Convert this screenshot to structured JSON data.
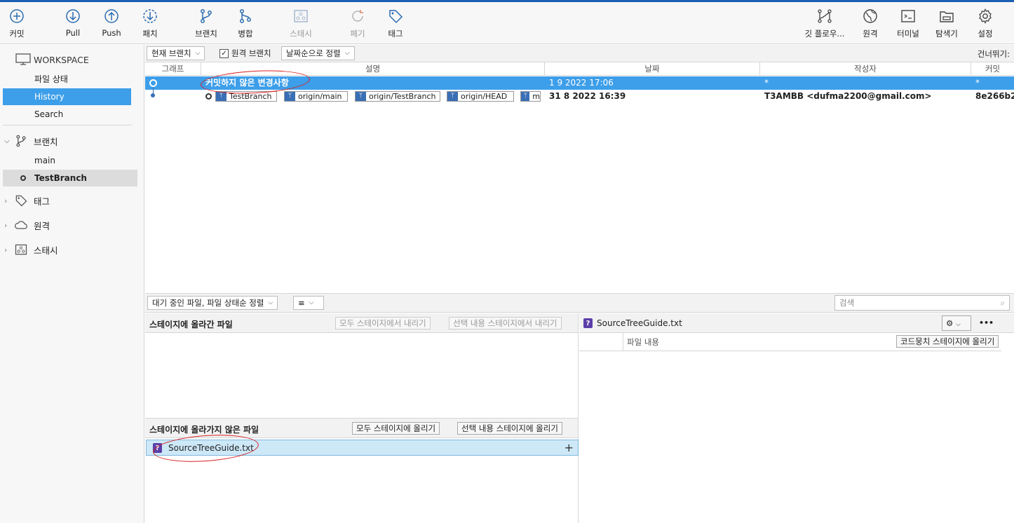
{
  "toolbar": {
    "left": [
      {
        "label": "커밋",
        "icon": "commit-icon"
      },
      {
        "label": "Pull",
        "icon": "pull-icon"
      },
      {
        "label": "Push",
        "icon": "push-icon"
      },
      {
        "label": "패치",
        "icon": "patch-icon"
      },
      {
        "label": "브랜치",
        "icon": "branch-icon"
      },
      {
        "label": "병합",
        "icon": "merge-icon"
      },
      {
        "label": "스태시",
        "icon": "stash-icon"
      },
      {
        "label": "폐기",
        "icon": "discard-icon"
      },
      {
        "label": "태그",
        "icon": "tag-icon"
      }
    ],
    "right": [
      {
        "label": "깃 플로우...",
        "icon": "git-flow-icon"
      },
      {
        "label": "원격",
        "icon": "remote-globe-icon"
      },
      {
        "label": "터미널",
        "icon": "terminal-icon"
      },
      {
        "label": "탐색기",
        "icon": "explorer-icon"
      },
      {
        "label": "설정",
        "icon": "settings-gear-icon"
      }
    ]
  },
  "sidebar": {
    "workspace": "WORKSPACE",
    "workspace_items": [
      "파일 상태",
      "History",
      "Search"
    ],
    "branches_label": "브랜치",
    "branches": [
      "main",
      "TestBranch"
    ],
    "tags_label": "태그",
    "remotes_label": "원격",
    "stashes_label": "스태시"
  },
  "history": {
    "branch_filter": "현재 브랜치",
    "remote_branches_label": "원격 브랜치",
    "sort": "날짜순으로 정렬",
    "jump_label": "건너뛰기:",
    "columns": [
      "그래프",
      "설명",
      "날짜",
      "작성자",
      "커밋"
    ],
    "rows": [
      {
        "description": "커밋하지 않은 변경사항",
        "date": "1 9 2022 17:06",
        "author": "*",
        "commit": "*"
      },
      {
        "refs": [
          "TestBranch",
          "origin/main",
          "origin/TestBranch",
          "origin/HEAD",
          "m"
        ],
        "date": "31 8 2022 16:39",
        "author": "T3AMBB <dufma2200@gmail.com>",
        "commit": "8e266b2"
      }
    ]
  },
  "files": {
    "sort_dropdown": "대기 중인 파일, 파일 상태순 정렬",
    "view_dropdown": "≡",
    "search_placeholder": "검색",
    "staged_title": "스테이지에 올라간 파일",
    "unstage_all": "모두 스테이지에서 내리기",
    "unstage_selected": "선택 내용 스테이지에서 내리기",
    "unstaged_title": "스테이지에 올라가지 않은 파일",
    "stage_all": "모두 스테이지에 올리기",
    "stage_selected": "선택 내용 스테이지에 올리기",
    "unstaged_files": [
      "SourceTreeGuide.txt"
    ],
    "diff_file": "SourceTreeGuide.txt",
    "diff_header": "파일 내용",
    "stage_hunk": "코드뭉치 스테이지에 올리기",
    "more": "•••"
  },
  "colors": {
    "accent": "#3d9ee9",
    "annotation": "#d82020"
  }
}
